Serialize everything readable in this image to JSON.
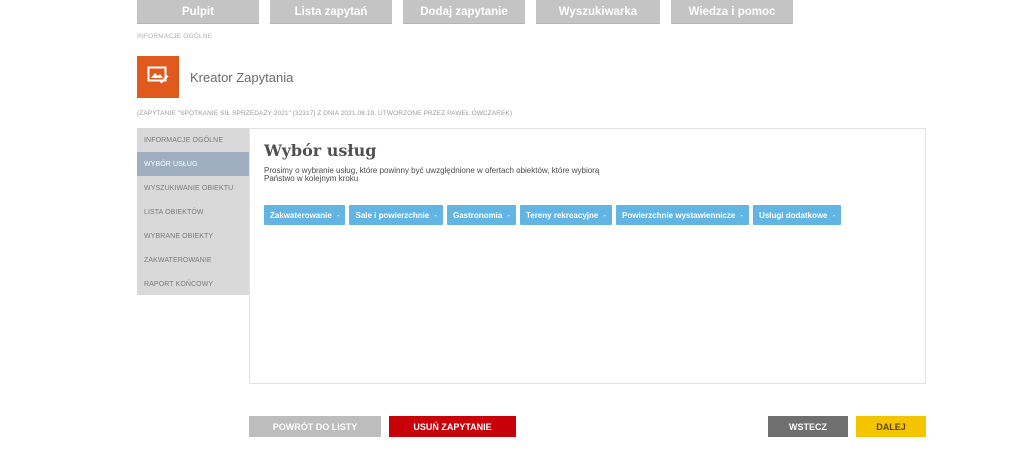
{
  "nav": {
    "items": [
      {
        "label": "Pulpit"
      },
      {
        "label": "Lista zapytań"
      },
      {
        "label": "Dodaj zapytanie"
      },
      {
        "label": "Wyszukiwarka"
      },
      {
        "label": "Wiedza i pomoc"
      }
    ]
  },
  "breadcrumb": "INFORMACJE OGÓLNE",
  "header": {
    "title": "Kreator Zapytania",
    "logo_icon": "image-edit-icon",
    "logo_color": "#e05a1e"
  },
  "info_line": "(ZAPYTANIE \"SPOTKANIE SIŁ SPRZEDAŻY 2021\" [32317] Z DNIA 2021.08.19, UTWORZONE PRZEZ PAWEŁ OWCZAREK)",
  "sidebar": {
    "items": [
      {
        "label": "INFORMACJE OGÓLNE"
      },
      {
        "label": "WYBÓR USŁUG",
        "active": true
      },
      {
        "label": "WYSZUKIWANIE OBIEKTU"
      },
      {
        "label": "LISTA OBIEKTÓW"
      },
      {
        "label": "WYBRANE OBIEKTY"
      },
      {
        "label": "ZAKWATEROWANIE"
      },
      {
        "label": "RAPORT KOŃCOWY"
      }
    ]
  },
  "main": {
    "title": "Wybór usług",
    "description_line1": "Prosimy o wybranie usług, które powinny być uwzględnione w ofertach obiektów, które wybiorą",
    "description_line2": "Państwo w kolejnym kroku",
    "services": [
      {
        "label": "Zakwaterowanie"
      },
      {
        "label": "Sale i powierzchnie"
      },
      {
        "label": "Gastronomia"
      },
      {
        "label": "Tereny rekreacyjne"
      },
      {
        "label": "Powierzchnie wystawiennicze"
      },
      {
        "label": "Usługi dodatkowe"
      }
    ],
    "service_caret": "-"
  },
  "footer": {
    "back_to_list": "POWRÓT DO LISTY",
    "delete_request": "USUŃ ZAPYTANIE",
    "back": "WSTECZ",
    "next": "DALEJ"
  },
  "colors": {
    "accent_orange": "#e05a1e",
    "service_blue": "#62b4e2",
    "delete_red": "#c8000a",
    "next_yellow": "#f5c400",
    "back_gray": "#6f6f6f",
    "list_gray": "#bdbdbd",
    "active_sidebar": "#9faec0"
  }
}
